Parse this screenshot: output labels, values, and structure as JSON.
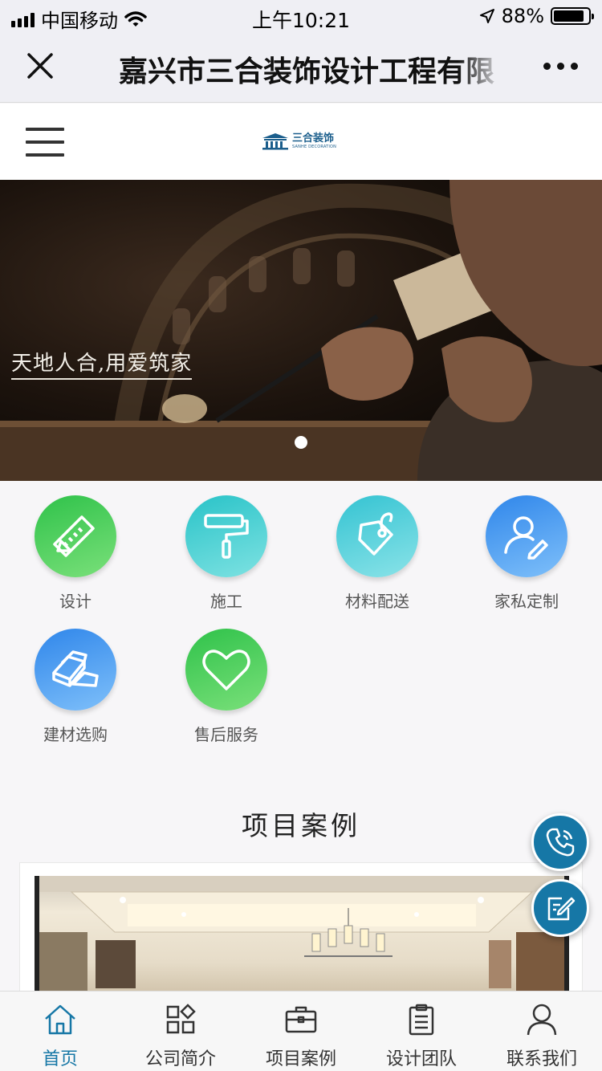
{
  "status_bar": {
    "carrier": "中国移动",
    "time": "上午10:21",
    "battery": "88%",
    "battery_level": 0.88
  },
  "title_bar": {
    "title": "嘉兴市三合装饰设计工程有限",
    "close_icon": "close-icon",
    "more_icon": "more-dots-icon"
  },
  "header": {
    "logo_cn": "三合装饰",
    "logo_en": "SANHE DECORATION",
    "menu_icon": "hamburger-icon"
  },
  "banner": {
    "slogan": "天地人合,用爱筑家",
    "slide_count": 1,
    "active_slide": 1
  },
  "categories": [
    {
      "label": "设计",
      "icon": "design-ruler-icon",
      "color": "#35c94a"
    },
    {
      "label": "施工",
      "icon": "paint-roller-icon",
      "color": "#33c9cc"
    },
    {
      "label": "材料配送",
      "icon": "tag-icon",
      "color": "#3fc6d3"
    },
    {
      "label": "家私定制",
      "icon": "user-edit-icon",
      "color": "#3a95ef"
    },
    {
      "label": "建材选购",
      "icon": "gold-bars-icon",
      "color": "#3a93ec"
    },
    {
      "label": "售后服务",
      "icon": "heart-icon",
      "color": "#35c94a"
    }
  ],
  "section": {
    "title": "项目案例"
  },
  "float_buttons": {
    "call_icon": "phone-icon",
    "message_icon": "edit-note-icon",
    "color": "#1677a6"
  },
  "tabs": [
    {
      "label": "首页",
      "icon": "home-icon",
      "active": true
    },
    {
      "label": "公司简介",
      "icon": "grid-icon",
      "active": false
    },
    {
      "label": "项目案例",
      "icon": "briefcase-icon",
      "active": false
    },
    {
      "label": "设计团队",
      "icon": "clipboard-icon",
      "active": false
    },
    {
      "label": "联系我们",
      "icon": "person-icon",
      "active": false
    }
  ]
}
